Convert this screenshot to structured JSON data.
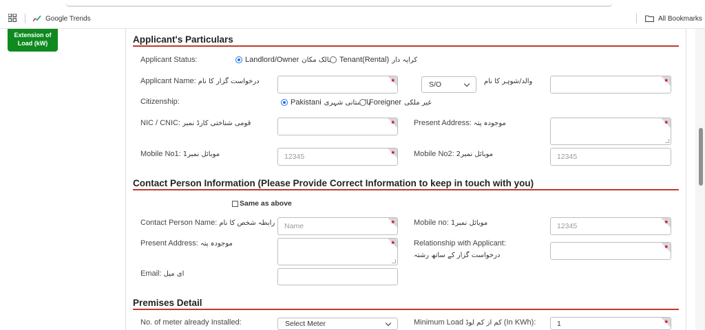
{
  "browser": {
    "bookmarks": [
      {
        "label": "Google Trends",
        "icon": "google-trends-icon"
      }
    ],
    "all_bookmarks": "All Bookmarks"
  },
  "sidebar": {
    "button_label": "Extension of Load (kW)"
  },
  "applicant": {
    "title": "Applicant's Particulars",
    "status_label": "Applicant Status:",
    "status_options": [
      {
        "label": "Landlord/Owner",
        "urdu": "مالک مکان",
        "checked": true
      },
      {
        "label": "Tenant(Rental)",
        "urdu": "کرایہ دار",
        "checked": false
      }
    ],
    "name_label": "Applicant Name:",
    "name_urdu": "درخواست گزار کا نام",
    "name_value": "",
    "relation_select": "S/O",
    "father_label_urdu": "والد/شوہر کا نام",
    "father_value": "",
    "citizenship_label": "Citizenship:",
    "citizenship_options": [
      {
        "label": "Pakistani",
        "urdu": "پاکستانی شہری",
        "checked": true
      },
      {
        "label": "Foreigner",
        "urdu": "غیر ملکی",
        "checked": false
      }
    ],
    "cnic_label": "NIC / CNIC:",
    "cnic_urdu": "قومی شناختی کارڈ نمبر",
    "cnic_value": "",
    "present_address_label": "Present Address:",
    "present_address_urdu": "موجودہ پتہ",
    "present_address_value": "",
    "mobile1_label": "Mobile No1:",
    "mobile1_urdu": "موبائل نمبر1",
    "mobile1_placeholder": "12345",
    "mobile2_label": "Mobile No2:",
    "mobile2_urdu": "موبائل نمبر2",
    "mobile2_placeholder": "12345"
  },
  "contact": {
    "title": "Contact Person Information (Please Provide Correct Information to keep in touch with you)",
    "same_as_above": "Same as above",
    "name_label": "Contact Person Name:",
    "name_urdu": "رابطہ شخص کا نام",
    "name_placeholder": "Name",
    "mobile_label": "Mobile no:",
    "mobile_urdu": "موبائل نمبر1",
    "mobile_placeholder": "12345",
    "address_label": "Present Address:",
    "address_urdu": "موجودہ پتہ",
    "address_value": "",
    "relationship_label": "Relationship with Applicant:",
    "relationship_urdu": "درخواست گزار کے ساتھ رشتہ",
    "relationship_value": "",
    "email_label": "Email:",
    "email_urdu": "ای میل",
    "email_value": ""
  },
  "premises": {
    "title": "Premises Detail",
    "meters_label": "No. of meter already Installed:",
    "meters_select": "Select Meter",
    "min_load_label": "Minimum Load",
    "min_load_urdu": "کم از کم لوڈ",
    "min_load_unit": "(In KWh):",
    "min_load_value": "1"
  },
  "colors": {
    "accent_red": "#c0392b",
    "green_button": "#0f8a1f",
    "radio_blue": "#1a73e8"
  }
}
